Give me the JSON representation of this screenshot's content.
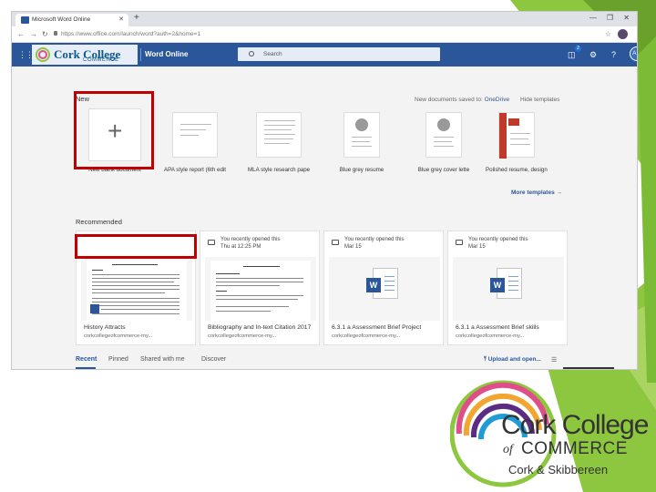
{
  "browser": {
    "tab_title": "Microsoft Word Online",
    "url": "https://www.office.com/launch/word?auth=2&home=1"
  },
  "office": {
    "logo_main": "Cork College",
    "logo_sub": "COMMERCE",
    "app_name": "Word Online",
    "search_placeholder": "Search",
    "notification_count": "2",
    "help": "?",
    "user_initials": "AM"
  },
  "new_section": {
    "title": "New",
    "saved_to": "New documents saved to:",
    "onedrive": "OneDrive",
    "hide": "Hide templates",
    "templates": [
      {
        "label": "New blank document"
      },
      {
        "label": "APA style report (6th editi..."
      },
      {
        "label": "MLA style research paper"
      },
      {
        "label": "Blue grey resume"
      },
      {
        "label": "Blue grey cover lette"
      },
      {
        "label": "Polished resume, designed..."
      }
    ],
    "more": "More templates"
  },
  "recommended": {
    "title": "Recommended",
    "cards": [
      {
        "opened": "",
        "when": "",
        "title": "History Attracts",
        "sub": "corkcollegeofcommerce-my..."
      },
      {
        "opened": "You recently opened this",
        "when": "Thu at 12:25 PM",
        "title": "Bibliography and In-text Citation 2017",
        "sub": "corkcollegeofcommerce-my..."
      },
      {
        "opened": "You recently opened this",
        "when": "Mar 15",
        "title": "6.3.1 a Assessment Brief Project",
        "sub": "corkcollegeofcommerce-my..."
      },
      {
        "opened": "You recently opened this",
        "when": "Mar 15",
        "title": "6.3.1 a Assessment Brief skills",
        "sub": "corkcollegeofcommerce-my..."
      }
    ]
  },
  "file_tabs": {
    "recent": "Recent",
    "pinned": "Pinned",
    "shared": "Shared with me",
    "discover": "Discover",
    "upload": "Upload and open..."
  },
  "brand": {
    "line1": "Cork College",
    "of": "of",
    "commerce": "COMMERCE",
    "line3": "Cork & Skibbereen"
  },
  "colors": {
    "accent_green": "#8dc63f",
    "office_blue": "#2b579a",
    "highlight_red": "#c00000"
  }
}
